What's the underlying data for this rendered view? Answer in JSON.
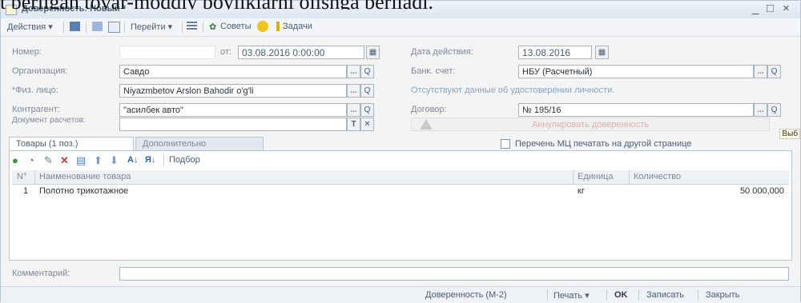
{
  "caption_line": "t berilgan tovar-moddiy boyliklarni olishga beriladi.",
  "window": {
    "title": "Доверенность: Новый *",
    "minimize": "_",
    "maximize": "□",
    "close": "×"
  },
  "toolbar": {
    "actions": "Действия ▾",
    "goto": "Перейти ▾",
    "tips": "Советы",
    "tasks": "Задачи"
  },
  "form": {
    "number_label": "Номер:",
    "number_value": "",
    "from_label": "от:",
    "from_value": "03.08.2016  0:00:00",
    "action_date_label": "Дата действия:",
    "action_date_value": "13.08.2016",
    "org_label": "Организация:",
    "org_value": "Савдо",
    "bank_label": "Банк. счет:",
    "bank_value": "НБУ (Расчетный)",
    "person_label": "*Физ. лицо:",
    "person_value": "Niyazmbetov  Arslon Bahodir o'g'li",
    "id_missing": "Отсутствуют данные об удостоверении личности.",
    "counterparty_label": "Контрагент:",
    "counterparty_value": "\"асилбек авто\"",
    "contract_label": "Договор:",
    "contract_value": "№ 195/16",
    "settlement_label": "Документ расчетов:",
    "settlement_value": "",
    "annul_button": "Аннулировать доверенность",
    "edge_tip": "Выб"
  },
  "tabs": [
    {
      "label": "Товары (1 поз.)"
    },
    {
      "label": "Дополнительно"
    }
  ],
  "print_other_page": "Перечень МЦ печатать на другой странице",
  "table_tools": {
    "select_label": "Подбор"
  },
  "table": {
    "columns": [
      "N°",
      "Наименование товара",
      "Единица",
      "Количество"
    ],
    "rows": [
      {
        "n": "1",
        "name": "Полотно трикотажное",
        "unit": "кг",
        "qty": "50 000,000"
      }
    ]
  },
  "comment_label": "Комментарий:",
  "footer": {
    "form_name": "Доверенность (М-2)",
    "print": "Печать ▾",
    "ok": "OK",
    "save": "Записать",
    "close": "Закрыть"
  }
}
